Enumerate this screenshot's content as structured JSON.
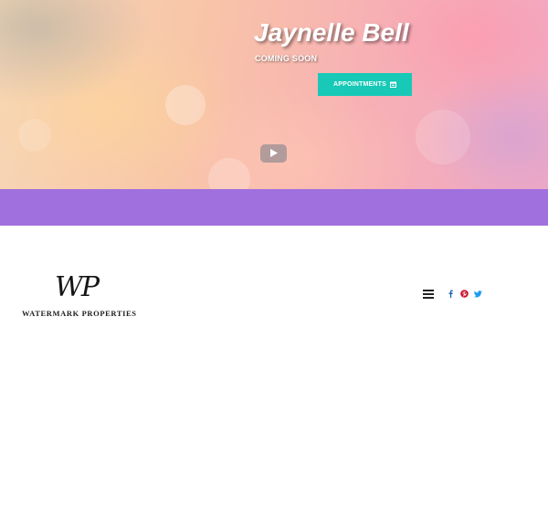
{
  "hero": {
    "name": "Jaynelle Bell",
    "subtitle": "COMING SOON",
    "appointments_label": "APPOINTMENTS",
    "appointments_icon": "calendar-icon",
    "video_icon": "youtube-play-icon"
  },
  "band": {
    "color": "#a070de"
  },
  "logo": {
    "monogram": "WP",
    "company": "WATERMARK PROPERTIES"
  },
  "header": {
    "menu_icon": "hamburger-menu-icon",
    "social": [
      {
        "name": "facebook",
        "icon": "facebook-icon",
        "color": "#1a5fb4"
      },
      {
        "name": "pinterest",
        "icon": "pinterest-icon",
        "color": "#c8102e"
      },
      {
        "name": "twitter",
        "icon": "twitter-icon",
        "color": "#1d9bf0"
      }
    ]
  },
  "colors": {
    "accent": "#17c9b6",
    "purple": "#a070de"
  }
}
